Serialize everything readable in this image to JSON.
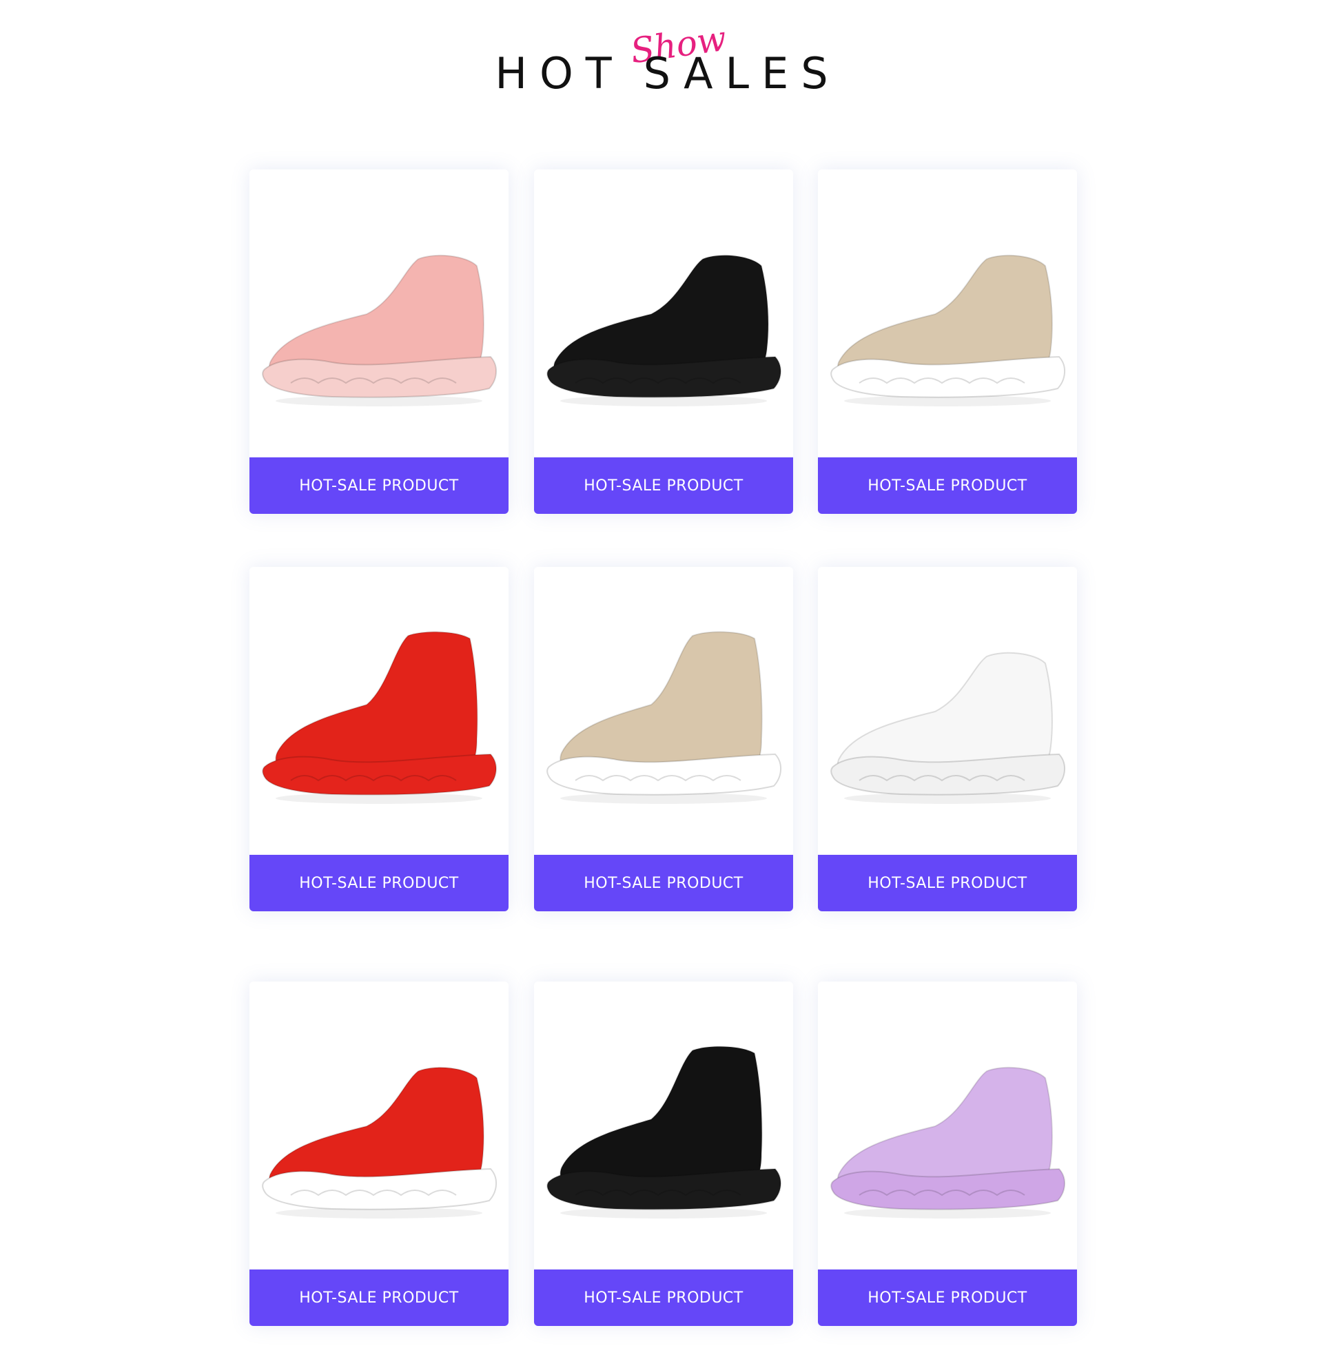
{
  "header": {
    "script_word": "Show",
    "title_part1": "HOT",
    "title_part2": "SALES",
    "script_color": "#e6207f"
  },
  "products": [
    {
      "label": "HOT-SALE PRODUCT",
      "shoe": "pink light-up sock sneaker",
      "upper": "#f4b4b0",
      "sole": "#f6cfcc",
      "icon": "shoe-image-icon"
    },
    {
      "label": "HOT-SALE PRODUCT",
      "shoe": "black sock sneaker",
      "upper": "#141414",
      "sole": "#1c1c1c",
      "icon": "shoe-image-icon"
    },
    {
      "label": "HOT-SALE PRODUCT",
      "shoe": "beige sock sneaker",
      "upper": "#d8c7ad",
      "sole": "#ffffff",
      "icon": "shoe-image-icon"
    },
    {
      "label": "HOT-SALE PRODUCT",
      "shoe": "red high-top sock sneaker",
      "upper": "#e2231a",
      "sole": "#e4241c",
      "icon": "shoe-image-icon"
    },
    {
      "label": "HOT-SALE PRODUCT",
      "shoe": "beige high-top sock sneaker",
      "upper": "#d8c6ab",
      "sole": "#ffffff",
      "icon": "shoe-image-icon"
    },
    {
      "label": "HOT-SALE PRODUCT",
      "shoe": "white sock sneaker",
      "upper": "#f7f7f7",
      "sole": "#f1f1f1",
      "icon": "shoe-image-icon"
    },
    {
      "label": "HOT-SALE PRODUCT",
      "shoe": "red striped sock sneaker",
      "upper": "#e2231a",
      "sole": "#ffffff",
      "icon": "shoe-image-icon"
    },
    {
      "label": "HOT-SALE PRODUCT",
      "shoe": "black high-top sock sneaker",
      "upper": "#121212",
      "sole": "#1a1a1a",
      "icon": "shoe-image-icon"
    },
    {
      "label": "HOT-SALE PRODUCT",
      "shoe": "lavender lace sneaker",
      "upper": "#d5b3ea",
      "sole": "#cfa6e6",
      "icon": "shoe-image-icon"
    }
  ],
  "colors": {
    "button_bg": "#6547f8",
    "button_text": "#ffffff",
    "title": "#111111"
  }
}
